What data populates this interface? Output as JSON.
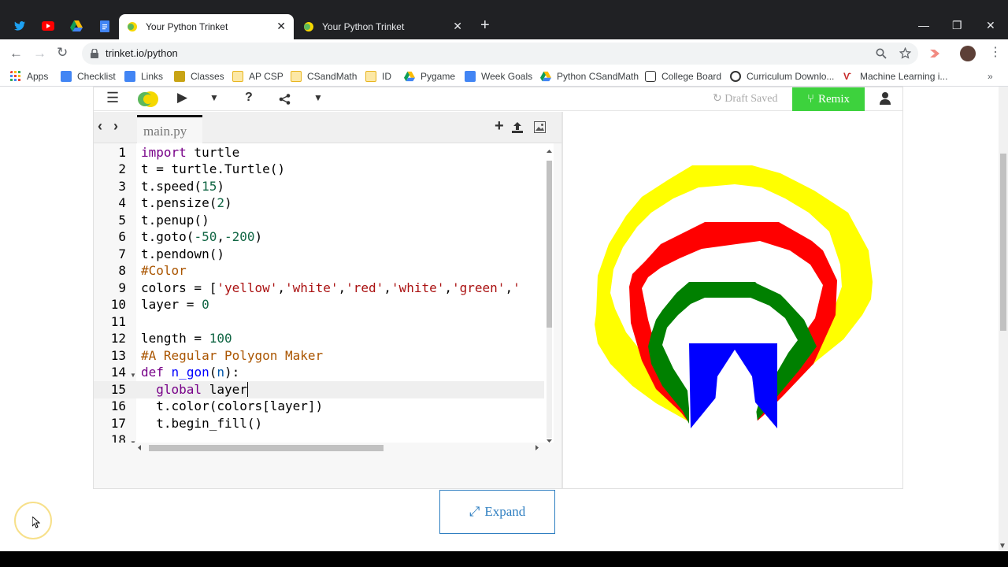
{
  "browser": {
    "tabs": [
      {
        "title": "Your Python Trinket",
        "active": true
      },
      {
        "title": "Your Python Trinket",
        "active": false
      }
    ],
    "url": "trinket.io/python",
    "bookmarks": [
      "Apps",
      "Checklist",
      "Links",
      "Classes",
      "AP CSP",
      "CSandMath",
      "ID",
      "Pygame",
      "Week Goals",
      "Python CSandMath",
      "College Board",
      "Curriculum Downlo...",
      "Machine Learning i..."
    ]
  },
  "trinket": {
    "draft_status": "Draft Saved",
    "remix_label": "Remix",
    "file_tab": "main.py",
    "expand_label": "Expand",
    "line_numbers": [
      "1",
      "2",
      "3",
      "4",
      "5",
      "6",
      "7",
      "8",
      "9",
      "10",
      "11",
      "12",
      "13",
      "14",
      "15",
      "16",
      "17",
      "18"
    ],
    "active_line": 15
  },
  "output": {
    "colors": [
      "yellow",
      "white",
      "red",
      "white",
      "green",
      "white",
      "blue"
    ]
  }
}
